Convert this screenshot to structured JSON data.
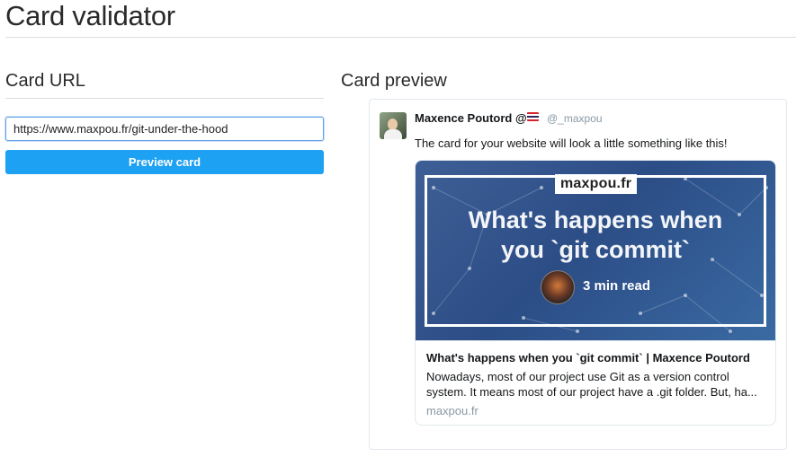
{
  "page": {
    "title": "Card validator"
  },
  "form": {
    "heading": "Card URL",
    "url_value": "https://www.maxpou.fr/git-under-the-hood",
    "preview_button_label": "Preview card",
    "accent_color": "#1da1f2"
  },
  "preview": {
    "heading": "Card preview",
    "tweet": {
      "display_name": "Maxence Poutord @",
      "flag_icon": "thailand-flag-icon",
      "username": "@_maxpou",
      "text": "The card for your website will look a little something like this!"
    },
    "card": {
      "image": {
        "site_badge": "maxpou.fr",
        "headline_line1": "What's happens when",
        "headline_line2": "you `git commit`",
        "read_time": "3 min read"
      },
      "title": "What's happens when you `git commit` | Maxence Poutord",
      "description_line1": "Nowadays, most of our project use Git as a version control",
      "description_line2": "system. It means most of our project have a .git folder. But, ha...",
      "domain": "maxpou.fr"
    }
  }
}
